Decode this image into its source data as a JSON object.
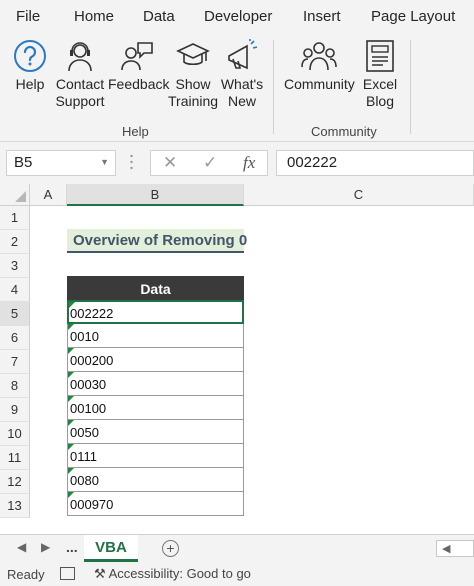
{
  "menu": {
    "tabs": [
      "File",
      "Home",
      "Data",
      "Developer",
      "Insert",
      "Page Layout"
    ]
  },
  "ribbon": {
    "help_group": {
      "label": "Help",
      "buttons": [
        {
          "label1": "Help",
          "label2": "",
          "icon": "help-icon"
        },
        {
          "label1": "Contact",
          "label2": "Support",
          "icon": "support-agent-icon"
        },
        {
          "label1": "Feedback",
          "label2": "",
          "icon": "feedback-icon"
        },
        {
          "label1": "Show",
          "label2": "Training",
          "icon": "training-icon"
        },
        {
          "label1": "What's",
          "label2": "New",
          "icon": "megaphone-icon"
        }
      ]
    },
    "community_group": {
      "label": "Community",
      "buttons": [
        {
          "label1": "Community",
          "label2": "",
          "icon": "community-icon"
        },
        {
          "label1": "Excel",
          "label2": "Blog",
          "icon": "blog-icon"
        }
      ]
    }
  },
  "formula_bar": {
    "name_box": "B5",
    "cancel_icon": "✕",
    "enter_icon": "✓",
    "fx_label": "fx",
    "value": "002222"
  },
  "grid": {
    "columns": [
      "A",
      "B",
      "C"
    ],
    "selected_column": "B",
    "rows": [
      "1",
      "2",
      "3",
      "4",
      "5",
      "6",
      "7",
      "8",
      "9",
      "10",
      "11",
      "12",
      "13"
    ],
    "title": "Overview of Removing 0",
    "table": {
      "header": "Data",
      "values": [
        "002222",
        "0010",
        "000200",
        "00030",
        "00100",
        "0050",
        "0111",
        "0080",
        "000970"
      ]
    }
  },
  "sheets": {
    "more": "...",
    "active": "VBA",
    "add": "+"
  },
  "status": {
    "ready": "Ready",
    "accessibility": "Accessibility: Good to go"
  },
  "colors": {
    "accent": "#217346",
    "title_fill": "#e2efda",
    "title_text": "#44546a",
    "header_fill": "#3a3a3a"
  }
}
